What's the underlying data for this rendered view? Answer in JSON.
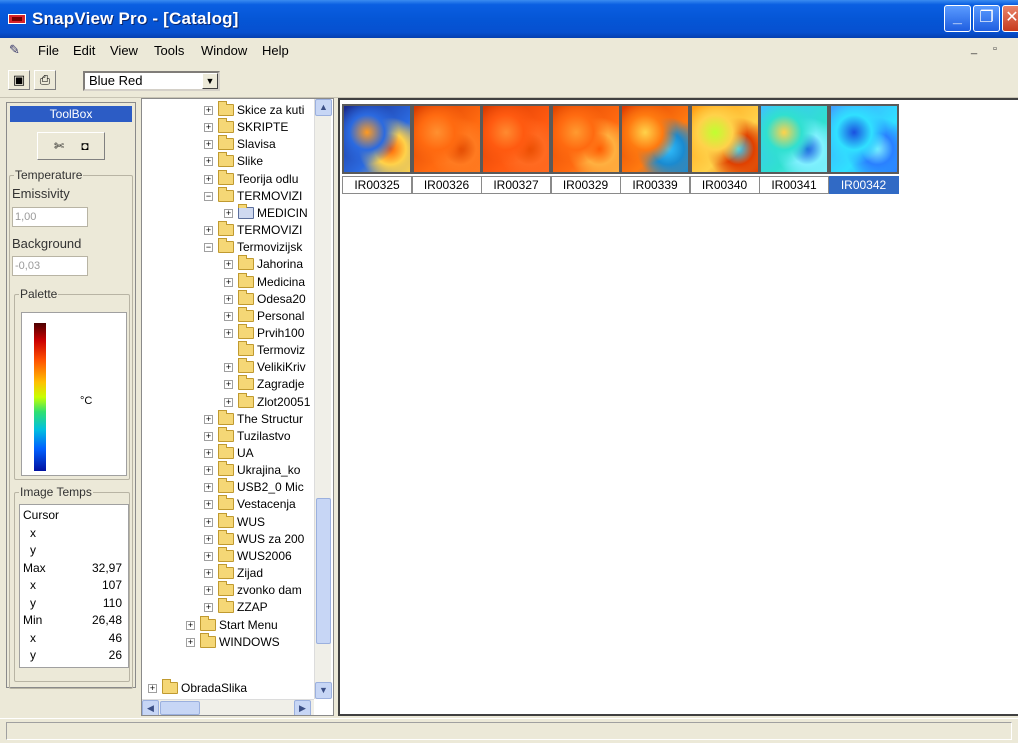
{
  "window": {
    "title": "SnapView Pro - [Catalog]",
    "title_bar_color": "#0556d6",
    "minimize_icon": "minimize-icon",
    "restore_icon": "restore-icon",
    "close_icon": "close-icon"
  },
  "menu": {
    "items": [
      "File",
      "Edit",
      "View",
      "Tools",
      "Window",
      "Help"
    ],
    "mdi_minimize": "_",
    "mdi_restore": "▫"
  },
  "toolbar": {
    "save_icon": "save-icon",
    "print_icon": "print-icon",
    "palette_value": "Blue Red",
    "palette_arrow": "▼"
  },
  "toolbox": {
    "header": "ToolBox",
    "tool_icons": [
      "edit-tool-icon",
      "camera-icon"
    ],
    "temperature_label": "Temperature",
    "emissivity_label": "Emissivity",
    "emissivity_value": "1,00",
    "background_label": "Background",
    "background_value": "-0,03",
    "palette_label": "Palette",
    "palette_unit": "°C",
    "image_temps_label": "Image Temps",
    "temps": [
      {
        "label": "Cursor",
        "value": "",
        "sub": false
      },
      {
        "label": "x",
        "value": "",
        "sub": true
      },
      {
        "label": "y",
        "value": "",
        "sub": true
      },
      {
        "label": "Max",
        "value": "32,97",
        "sub": false
      },
      {
        "label": "x",
        "value": "107",
        "sub": true
      },
      {
        "label": "y",
        "value": "110",
        "sub": true
      },
      {
        "label": "Min",
        "value": "26,48",
        "sub": false
      },
      {
        "label": "x",
        "value": "46",
        "sub": true
      },
      {
        "label": "y",
        "value": "26",
        "sub": true
      }
    ]
  },
  "tree": {
    "items": [
      {
        "label": "Skice za kuti",
        "level": 3,
        "expander": "+",
        "icon": "folder"
      },
      {
        "label": "SKRIPTE",
        "level": 3,
        "expander": "+",
        "icon": "folder"
      },
      {
        "label": "Slavisa",
        "level": 3,
        "expander": "+",
        "icon": "folder"
      },
      {
        "label": "Slike",
        "level": 3,
        "expander": "+",
        "icon": "folder"
      },
      {
        "label": "Teorija odlu",
        "level": 3,
        "expander": "+",
        "icon": "folder"
      },
      {
        "label": "TERMOVIZI",
        "level": 3,
        "expander": "−",
        "icon": "folder"
      },
      {
        "label": "MEDICIN",
        "level": 4,
        "expander": "+",
        "icon": "special"
      },
      {
        "label": "TERMOVIZI",
        "level": 3,
        "expander": "+",
        "icon": "folder"
      },
      {
        "label": "Termovizijsk",
        "level": 3,
        "expander": "−",
        "icon": "folder"
      },
      {
        "label": "Jahorina",
        "level": 4,
        "expander": "+",
        "icon": "folder"
      },
      {
        "label": "Medicina",
        "level": 4,
        "expander": "+",
        "icon": "folder"
      },
      {
        "label": "Odesa20",
        "level": 4,
        "expander": "+",
        "icon": "folder"
      },
      {
        "label": "Personal",
        "level": 4,
        "expander": "+",
        "icon": "folder"
      },
      {
        "label": "Prvih100",
        "level": 4,
        "expander": "+",
        "icon": "folder"
      },
      {
        "label": "Termoviz",
        "level": 4,
        "expander": "",
        "icon": "folder"
      },
      {
        "label": "VelikiKriv",
        "level": 4,
        "expander": "+",
        "icon": "folder"
      },
      {
        "label": "Zagradje",
        "level": 4,
        "expander": "+",
        "icon": "folder"
      },
      {
        "label": "Zlot20051",
        "level": 4,
        "expander": "+",
        "icon": "folder"
      },
      {
        "label": "The Structur",
        "level": 3,
        "expander": "+",
        "icon": "folder"
      },
      {
        "label": "Tuzilastvo",
        "level": 3,
        "expander": "+",
        "icon": "folder"
      },
      {
        "label": "UA",
        "level": 3,
        "expander": "+",
        "icon": "folder"
      },
      {
        "label": "Ukrajina_ko",
        "level": 3,
        "expander": "+",
        "icon": "folder"
      },
      {
        "label": "USB2_0 Mic",
        "level": 3,
        "expander": "+",
        "icon": "folder"
      },
      {
        "label": "Vestacenja",
        "level": 3,
        "expander": "+",
        "icon": "folder"
      },
      {
        "label": "WUS",
        "level": 3,
        "expander": "+",
        "icon": "folder"
      },
      {
        "label": "WUS za 200",
        "level": 3,
        "expander": "+",
        "icon": "folder"
      },
      {
        "label": "WUS2006",
        "level": 3,
        "expander": "+",
        "icon": "folder"
      },
      {
        "label": "Zijad",
        "level": 3,
        "expander": "+",
        "icon": "folder"
      },
      {
        "label": "zvonko dam",
        "level": 3,
        "expander": "+",
        "icon": "folder"
      },
      {
        "label": "ZZAP",
        "level": 3,
        "expander": "+",
        "icon": "folder"
      },
      {
        "label": "Start Menu",
        "level": 2,
        "expander": "+",
        "icon": "folder"
      },
      {
        "label": "WINDOWS",
        "level": 2,
        "expander": "+",
        "icon": "folder"
      },
      {
        "label": "ObradaSlika",
        "level": 1,
        "expander": "+",
        "icon": "folder"
      }
    ],
    "scroll_up": "▲",
    "scroll_down": "▼",
    "scroll_left": "◀",
    "scroll_right": "▶"
  },
  "catalog": {
    "thumbnails": [
      {
        "label": "IR00325",
        "selected": false,
        "colors": [
          "#1a2a8a",
          "#2b6ae0",
          "#ff9a20",
          "#ff6000",
          "#ffd24a"
        ]
      },
      {
        "label": "IR00326",
        "selected": false,
        "colors": [
          "#d63a00",
          "#ff6a10",
          "#ff9030",
          "#e04800",
          "#ff7a20"
        ]
      },
      {
        "label": "IR00327",
        "selected": false,
        "colors": [
          "#d83a00",
          "#ff5a10",
          "#ff8a30",
          "#e84c00",
          "#ff6a20"
        ]
      },
      {
        "label": "IR00329",
        "selected": false,
        "colors": [
          "#e04400",
          "#ff6a10",
          "#ff9a30",
          "#ff5a00",
          "#ffb040"
        ]
      },
      {
        "label": "IR00339",
        "selected": false,
        "colors": [
          "#e03a00",
          "#ff7a10",
          "#ffd24a",
          "#30c0ff",
          "#1a8ad0"
        ]
      },
      {
        "label": "IR00340",
        "selected": false,
        "colors": [
          "#ff9a10",
          "#ffd24a",
          "#c0ff30",
          "#30d0ff",
          "#e04000"
        ]
      },
      {
        "label": "IR00341",
        "selected": false,
        "colors": [
          "#40c0ff",
          "#30e0d0",
          "#ffd24a",
          "#1a5ae0",
          "#80f0ff"
        ]
      },
      {
        "label": "IR00342",
        "selected": true,
        "colors": [
          "#40a0ff",
          "#30e0ff",
          "#1a50e0",
          "#80f0ff",
          "#2a80ff"
        ]
      }
    ]
  }
}
